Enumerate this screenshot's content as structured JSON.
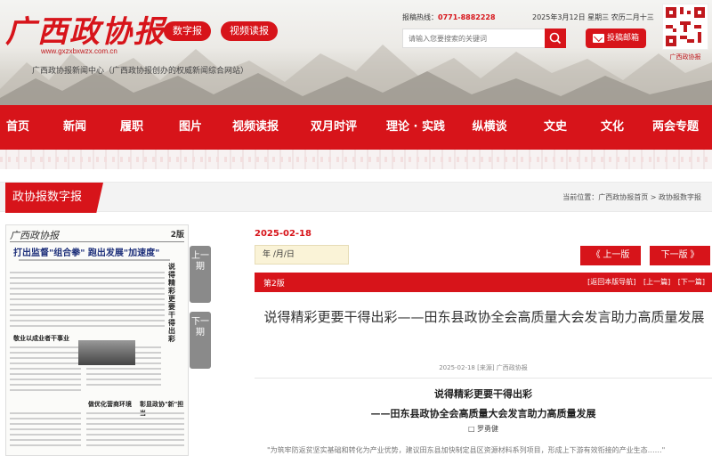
{
  "header": {
    "logo_text": "广西政协报",
    "logo_url": "www.gxzxbxwzx.com.cn",
    "subtitle": "广西政协报新闻中心（广西政协报创办的权威新闻综合网站）",
    "digital_btn": "数字报",
    "video_btn": "视频读报",
    "hotline_label": "报稿热线：",
    "hotline_number": "0771-8882228",
    "date_text": "2025年3月12日 星期三 农历二月十三",
    "search_placeholder": "请输入您要搜索的关键词",
    "mail_btn": "投稿邮箱",
    "qr_label": "广西政协报"
  },
  "nav": {
    "items": [
      "首页",
      "新闻",
      "履职",
      "图片",
      "视频读报",
      "双月时评",
      "理论 · 实践",
      "纵横谈",
      "文史",
      "文化",
      "两会专题"
    ]
  },
  "section": {
    "tab": "政协报数字报",
    "breadcrumb": "当前位置：广西政协报首页 > 政协报数字报"
  },
  "paper": {
    "masthead": "广西政协报",
    "page_no": "2版",
    "headline": "打出监督\"组合拳\" 跑出发展\"加速度\"",
    "side_headline": "说得精彩更要干得出彩",
    "sub1": "敬业以成业者干事业",
    "sub2": "做优化营商环境",
    "sub3": "彰显政协\"新\"担当",
    "prev_btn": "上一期",
    "next_btn": "下一期"
  },
  "content": {
    "issue_date": "2025-02-18",
    "date_input": "年 /月/日",
    "prev_edition": "《 上一版",
    "next_edition": "下一版 》",
    "page_label": "第2版",
    "page_links": [
      "[返回本版导航]",
      "[上一篇]",
      "[下一篇]"
    ],
    "title": "说得精彩更要干得出彩——田东县政协全会高质量大会发言助力高质量发展",
    "meta": "2025-02-18 [来源] 广西政协报",
    "body_title1": "说得精彩更要干得出彩",
    "body_title2": "——田东县政协全会高质量大会发言助力高质量发展",
    "author": "□ 罗勇健",
    "body_text": "\"为筑牢防返贫坚实基础和转化为产业优势，建议田东县加快制定县区资源材料系列项目，形成上下游有效衔接的产业生态……\""
  },
  "colors": {
    "brand_red": "#d7141a",
    "nav_bg": "#d7141a",
    "date_field_bg": "#faf3d7"
  }
}
